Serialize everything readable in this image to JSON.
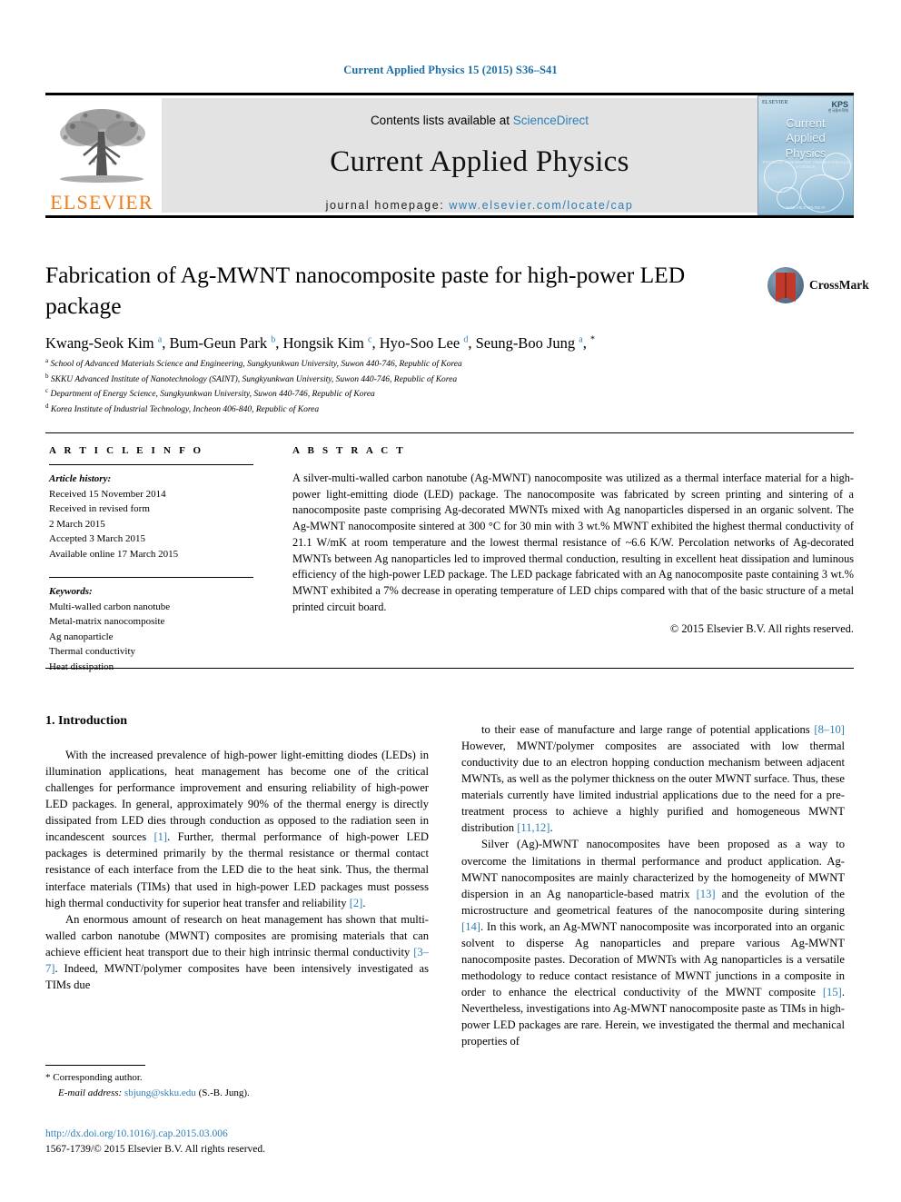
{
  "running_head": "Current Applied Physics 15 (2015) S36–S41",
  "masthead": {
    "contents_prefix": "Contents lists available at ",
    "sciencedirect": "ScienceDirect",
    "journal_name": "Current Applied Physics",
    "homepage_prefix": "journal homepage: ",
    "homepage_url": "www.elsevier.com/locate/cap",
    "publisher_wordmark": "ELSEVIER",
    "publisher_color": "#ef7d1a",
    "link_color": "#2b7fb8"
  },
  "cover": {
    "elsevier_small": "ELSEVIER",
    "society_mark": "KPS",
    "society_sub": "한국물리학회",
    "title_line1": "Current",
    "title_line2": "Applied",
    "title_line3": "Physics",
    "subtitle": "PHYSICS, CHEMISTRY AND MATERIALS SCIENCE",
    "footer": "AVAILABLE ONLINE AT"
  },
  "article": {
    "title": "Fabrication of Ag-MWNT nanocomposite paste for high-power LED package",
    "crossmark_label": "CrossMark",
    "authors_html": "Kwang-Seok Kim <sup>a</sup>, Bum-Geun Park <sup>b</sup>, Hongsik Kim <sup>c</sup>, Hyo-Soo Lee <sup>d</sup>, Seung-Boo Jung <sup>a</sup>, <sup class=\"star\">*</sup>",
    "affiliations": [
      {
        "mark": "a",
        "text": "School of Advanced Materials Science and Engineering, Sungkyunkwan University, Suwon 440-746, Republic of Korea"
      },
      {
        "mark": "b",
        "text": "SKKU Advanced Institute of Nanotechnology (SAINT), Sungkyunkwan University, Suwon 440-746, Republic of Korea"
      },
      {
        "mark": "c",
        "text": "Department of Energy Science, Sungkyunkwan University, Suwon 440-746, Republic of Korea"
      },
      {
        "mark": "d",
        "text": "Korea Institute of Industrial Technology, Incheon 406-840, Republic of Korea"
      }
    ]
  },
  "article_info": {
    "heading": "A R T I C L E  I N F O",
    "history_label": "Article history:",
    "history": [
      "Received 15 November 2014",
      "Received in revised form",
      "2 March 2015",
      "Accepted 3 March 2015",
      "Available online 17 March 2015"
    ],
    "keywords_label": "Keywords:",
    "keywords": [
      "Multi-walled carbon nanotube",
      "Metal-matrix nanocomposite",
      "Ag nanoparticle",
      "Thermal conductivity",
      "Heat dissipation"
    ]
  },
  "abstract": {
    "heading": "A B S T R A C T",
    "text": "A silver-multi-walled carbon nanotube (Ag-MWNT) nanocomposite was utilized as a thermal interface material for a high-power light-emitting diode (LED) package. The nanocomposite was fabricated by screen printing and sintering of a nanocomposite paste comprising Ag-decorated MWNTs mixed with Ag nanoparticles dispersed in an organic solvent. The Ag-MWNT nanocomposite sintered at 300 °C for 30 min with 3 wt.% MWNT exhibited the highest thermal conductivity of 21.1 W/mK at room temperature and the lowest thermal resistance of ~6.6 K/W. Percolation networks of Ag-decorated MWNTs between Ag nanoparticles led to improved thermal conduction, resulting in excellent heat dissipation and luminous efficiency of the high-power LED package. The LED package fabricated with an Ag nanocomposite paste containing 3 wt.% MWNT exhibited a 7% decrease in operating temperature of LED chips compared with that of the basic structure of a metal printed circuit board.",
    "copyright": "© 2015 Elsevier B.V. All rights reserved."
  },
  "body": {
    "section_title": "1. Introduction",
    "left_paragraphs": [
      "With the increased prevalence of high-power light-emitting diodes (LEDs) in illumination applications, heat management has become one of the critical challenges for performance improvement and ensuring reliability of high-power LED packages. In general, approximately 90% of the thermal energy is directly dissipated from LED dies through conduction as opposed to the radiation seen in incandescent sources [1]. Further, thermal performance of high-power LED packages is determined primarily by the thermal resistance or thermal contact resistance of each interface from the LED die to the heat sink. Thus, the thermal interface materials (TIMs) that used in high-power LED packages must possess high thermal conductivity for superior heat transfer and reliability [2].",
      "An enormous amount of research on heat management has shown that multi-walled carbon nanotube (MWNT) composites are promising materials that can achieve efficient heat transport due to their high intrinsic thermal conductivity [3–7]. Indeed, MWNT/polymer composites have been intensively investigated as TIMs due"
    ],
    "right_paragraphs": [
      "to their ease of manufacture and large range of potential applications [8–10] However, MWNT/polymer composites are associated with low thermal conductivity due to an electron hopping conduction mechanism between adjacent MWNTs, as well as the polymer thickness on the outer MWNT surface. Thus, these materials currently have limited industrial applications due to the need for a pre-treatment process to achieve a highly purified and homogeneous MWNT distribution [11,12].",
      "Silver (Ag)-MWNT nanocomposites have been proposed as a way to overcome the limitations in thermal performance and product application. Ag-MWNT nanocomposites are mainly characterized by the homogeneity of MWNT dispersion in an Ag nanoparticle-based matrix [13] and the evolution of the microstructure and geometrical features of the nanocomposite during sintering [14]. In this work, an Ag-MWNT nanocomposite was incorporated into an organic solvent to disperse Ag nanoparticles and prepare various Ag-MWNT nanocomposite pastes. Decoration of MWNTs with Ag nanoparticles is a versatile methodology to reduce contact resistance of MWNT junctions in a composite in order to enhance the electrical conductivity of the MWNT composite [15]. Nevertheless, investigations into Ag-MWNT nanocomposite paste as TIMs in high-power LED packages are rare. Herein, we investigated the thermal and mechanical properties of"
    ]
  },
  "footer": {
    "corresponding_marker": "*",
    "corresponding_label": "Corresponding author.",
    "email_label": "E-mail address:",
    "email": "sbjung@skku.edu",
    "email_owner": "(S.-B. Jung).",
    "doi_url": "http://dx.doi.org/10.1016/j.cap.2015.03.006",
    "issn_line": "1567-1739/© 2015 Elsevier B.V. All rights reserved."
  }
}
